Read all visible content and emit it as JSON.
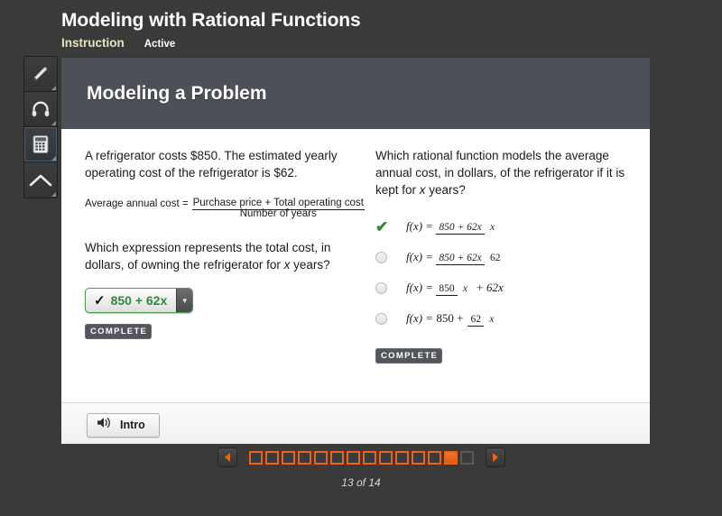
{
  "header": {
    "lesson_title": "Modeling with Rational Functions",
    "tab_instruction": "Instruction",
    "tab_active": "Active"
  },
  "toolbar": {
    "items": [
      {
        "name": "pencil-icon",
        "label": "Pencil",
        "selected": false
      },
      {
        "name": "headphones-icon",
        "label": "Headphones",
        "selected": false
      },
      {
        "name": "calculator-icon",
        "label": "Calculator",
        "selected": true
      },
      {
        "name": "collapse-up-icon",
        "label": "Collapse",
        "selected": false
      }
    ]
  },
  "panel": {
    "title": "Modeling a Problem"
  },
  "left_column": {
    "prompt": "A refrigerator costs $850. The estimated yearly operating cost of the refrigerator is $62.",
    "formula": {
      "lead": "Average annual cost = ",
      "numerator": "Purchase price + Total operating cost",
      "denominator": "Number of years"
    },
    "question_part1": "Which expression represents the total cost, in dollars, of owning the refrigerator for ",
    "question_part1_var": "x",
    "question_part1_end": " years?",
    "dropdown": {
      "check": "✓",
      "value": "850 + 62x",
      "arrow": "▼"
    },
    "complete_label": "COMPLETE"
  },
  "right_column": {
    "question_part1": "Which rational function models the average annual cost, in dollars, of the refrigerator if it is kept for ",
    "question_part1_var": "x",
    "question_part1_end": " years?",
    "options": [
      {
        "id": "option-a",
        "selected": true,
        "marker": "✔",
        "lhs": "f(x)",
        "eq": "=",
        "kind": "fraction",
        "numerator": "850 + 62x",
        "denominator": "x",
        "trailing": ""
      },
      {
        "id": "option-b",
        "selected": false,
        "marker": "",
        "lhs": "f(x)",
        "eq": "=",
        "kind": "fraction",
        "numerator": "850 + 62x",
        "denominator": "62",
        "trailing": ""
      },
      {
        "id": "option-c",
        "selected": false,
        "marker": "",
        "lhs": "f(x)",
        "eq": "=",
        "kind": "fraction-plus",
        "numerator": "850",
        "denominator": "x",
        "trailing": "+ 62x"
      },
      {
        "id": "option-d",
        "selected": false,
        "marker": "",
        "lhs": "f(x)",
        "eq": "=",
        "kind": "leading-fraction",
        "leading": "850 +",
        "numerator": "62",
        "denominator": "x",
        "trailing": ""
      }
    ],
    "complete_label": "COMPLETE"
  },
  "footer": {
    "intro_label": "Intro",
    "audio_icon": "speaker-icon"
  },
  "pager": {
    "prev_label": "◀",
    "next_label": "▶",
    "total_pages": 14,
    "current_page": 13,
    "page_label": "13 of 14",
    "squares": [
      "visited",
      "visited",
      "visited",
      "visited",
      "visited",
      "visited",
      "visited",
      "visited",
      "visited",
      "visited",
      "visited",
      "visited",
      "current",
      "locked"
    ]
  },
  "colors": {
    "background": "#3a3a3a",
    "panel_header": "#4e5058",
    "accent_orange": "#e8641a",
    "correct_green": "#2f8a33",
    "tab_cream": "#e9e2c1"
  }
}
